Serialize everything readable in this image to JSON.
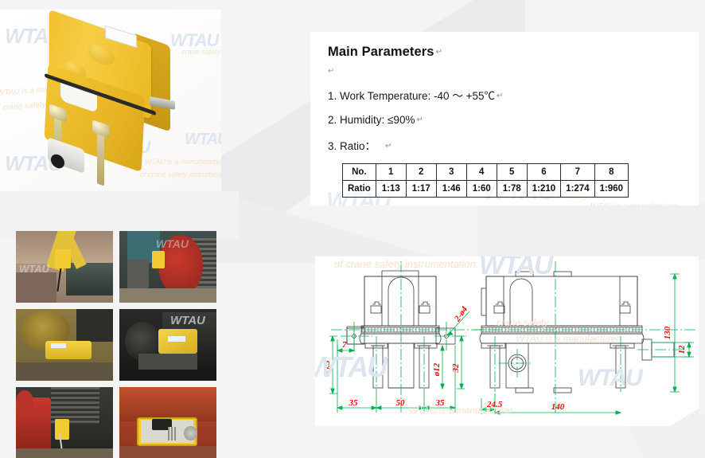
{
  "page": {
    "background_color": "#f4f4f5",
    "panel_color": "#ffffff"
  },
  "watermarks": {
    "brand": "WTAU",
    "tagline_line1": "WTAU is a manufacturer",
    "tagline_line2": "of crane safety instrumentation.",
    "short_tag": "crane safety",
    "registered_mark": "®",
    "color_blue": "#dde6ef",
    "color_orange": "#f6e2cd"
  },
  "hero": {
    "name": "product-photo-limit-switch",
    "alt": "Yellow crane rotary limit switch, three-quarter view",
    "body_color": "#f0c02f",
    "shaft_color": "#c9c9c3",
    "gland_color": "#e6e6e1"
  },
  "photo_grid": {
    "caption": "",
    "items": [
      {
        "name": "photo-tower-crane-drum",
        "alt": "Limit switch mounted on tower crane hoist drum outdoors"
      },
      {
        "name": "photo-red-winch-drum",
        "alt": "Limit switch mounted beside red winch drum"
      },
      {
        "name": "photo-yellow-gearbox",
        "alt": "Yellow limit switch bolted to hoist gearbox housing"
      },
      {
        "name": "photo-black-motor",
        "alt": "Yellow limit switch coupled to black electric motor shaft"
      },
      {
        "name": "photo-red-gearbox",
        "alt": "Limit switch beside red gearbox and wire rope drum"
      },
      {
        "name": "photo-open-housing",
        "alt": "Limit switch with cover removed showing cam stack internals"
      }
    ]
  },
  "parameters": {
    "heading": "Main Parameters",
    "return_mark": "↵",
    "lines": [
      "1. Work Temperature: -40 ～ +55℃",
      "2. Humidity:  ≤90%",
      "3. Ratio："
    ],
    "table": {
      "row_headers": [
        "No.",
        "Ratio"
      ],
      "columns": [
        "1",
        "2",
        "3",
        "4",
        "5",
        "6",
        "7",
        "8"
      ],
      "ratios": [
        "1:13",
        "1:17",
        "1:46",
        "1:60",
        "1:78",
        "1:210",
        "1:274",
        "1:960"
      ]
    }
  },
  "drawing": {
    "title": "dimension-drawing",
    "line_color": "#3a3a3a",
    "center_line_color": "#00b050",
    "dimension_text_color": "#ff0000",
    "views": [
      {
        "name": "front-view",
        "label": "front"
      },
      {
        "name": "side-view",
        "label": "side"
      }
    ],
    "dimensions": {
      "front": {
        "d_7": "7",
        "d_33_5": "33.5",
        "d_35_left": "35",
        "d_50": "50",
        "d_35_right": "35",
        "d_32": "32",
        "d_phi12": "ø12",
        "d_2_phi4": "2-ø4"
      },
      "side": {
        "d_24_5": "24.5",
        "d_140": "140",
        "d_130": "130",
        "d_12": "12"
      }
    }
  }
}
